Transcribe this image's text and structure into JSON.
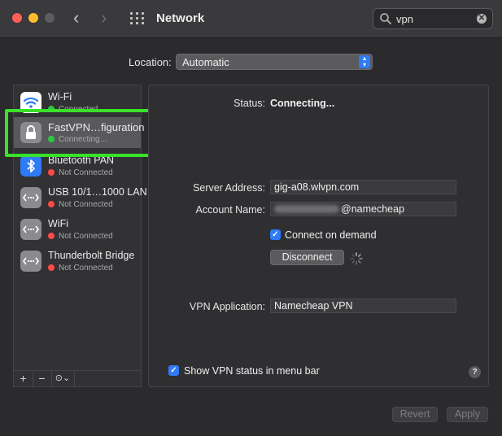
{
  "window": {
    "title": "Network",
    "nav_back": "‹",
    "nav_forward": "›",
    "search": {
      "value": "vpn",
      "clear": "✕"
    }
  },
  "location": {
    "label": "Location:",
    "value": "Automatic"
  },
  "services": [
    {
      "name": "Wi-Fi",
      "status": "Connected",
      "status_color": "#2bc840",
      "icon": "wifi-icon",
      "icon_bg": "#ffffff"
    },
    {
      "name": "FastVPN…figuration",
      "status": "Connecting…",
      "status_color": "#2bc840",
      "icon": "lock-icon",
      "icon_bg": "#8b8a8e"
    },
    {
      "name": "Bluetooth PAN",
      "status": "Not Connected",
      "status_color": "#fe4a49",
      "icon": "bluetooth-icon",
      "icon_bg": "#2f7bf6"
    },
    {
      "name": "USB 10/1…1000 LAN",
      "status": "Not Connected",
      "status_color": "#fe4a49",
      "icon": "ethernet-icon",
      "icon_bg": "#8b8a8e"
    },
    {
      "name": "WiFi",
      "status": "Not Connected",
      "status_color": "#fe4a49",
      "icon": "ethernet-icon",
      "icon_bg": "#8b8a8e"
    },
    {
      "name": "Thunderbolt Bridge",
      "status": "Not Connected",
      "status_color": "#fe4a49",
      "icon": "ethernet-icon",
      "icon_bg": "#8b8a8e"
    }
  ],
  "sidebar_toolbar": {
    "add": "+",
    "remove": "−",
    "action": "⊙⌄"
  },
  "detail": {
    "status_label": "Status:",
    "status_value": "Connecting...",
    "server_label": "Server Address:",
    "server_value": "gig-a08.wlvpn.com",
    "account_label": "Account Name:",
    "account_suffix": "@namecheap",
    "connect_on_demand": "Connect on demand",
    "disconnect": "Disconnect",
    "vpn_app_label": "VPN Application:",
    "vpn_app_value": "Namecheap VPN",
    "show_status": "Show VPN status in menu bar",
    "help": "?"
  },
  "footer": {
    "revert": "Revert",
    "apply": "Apply"
  },
  "colors": {
    "accent": "#2f7bf6",
    "highlight": "#38e22a"
  }
}
